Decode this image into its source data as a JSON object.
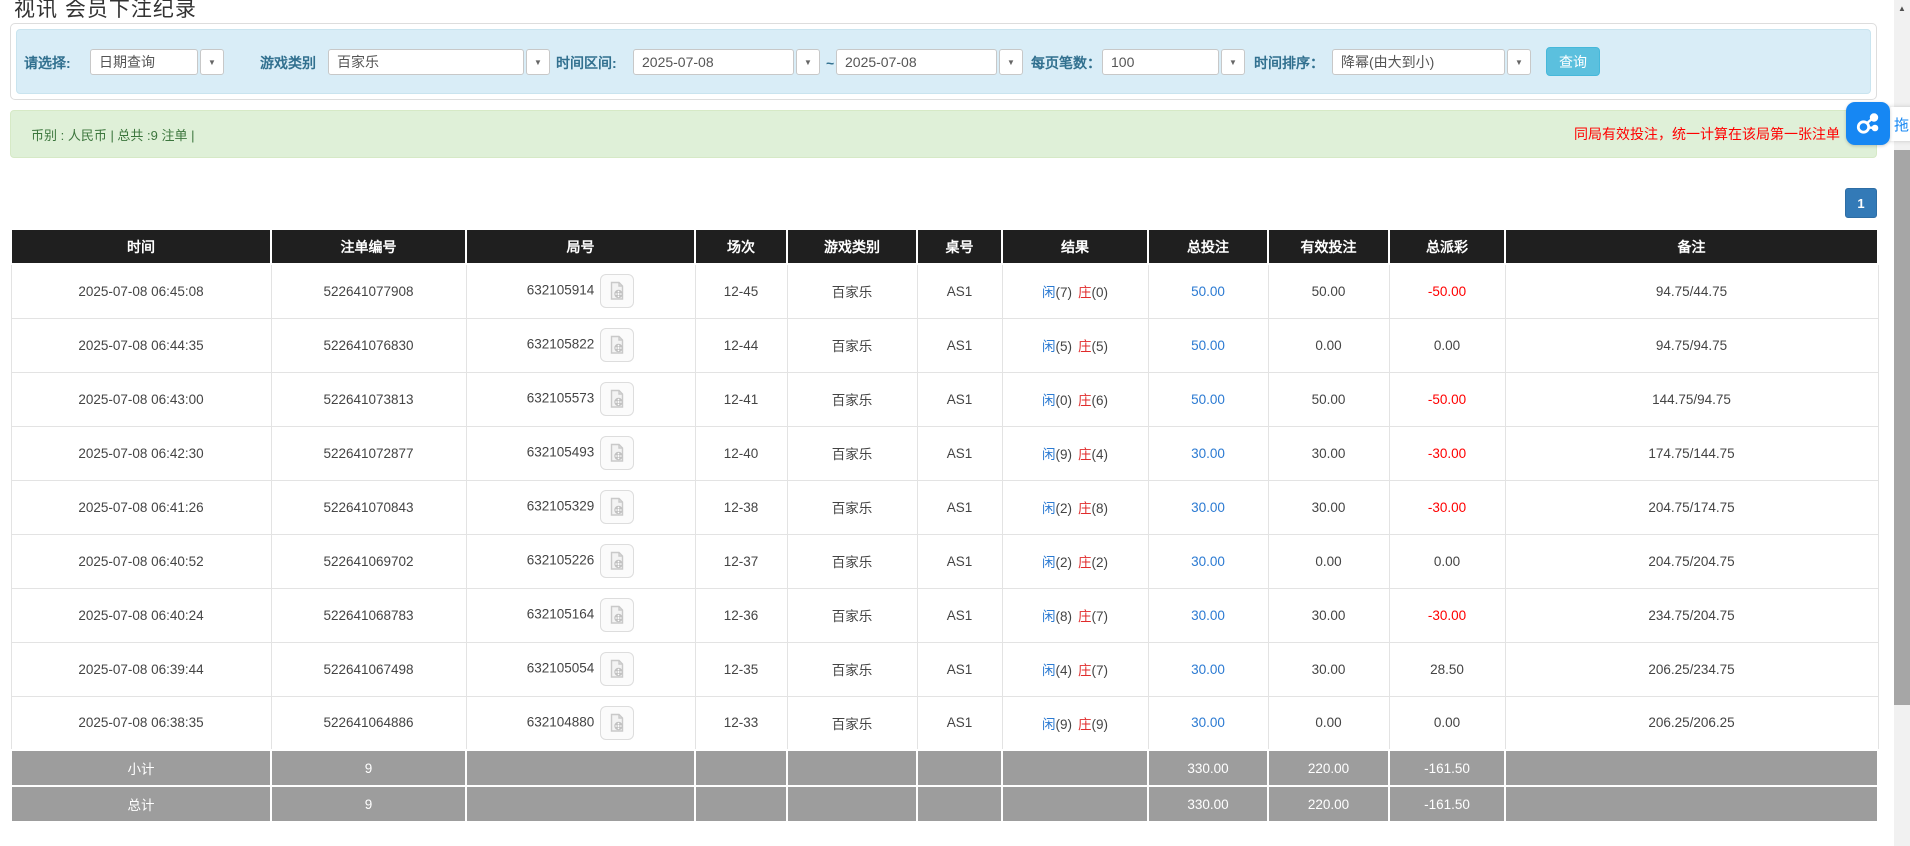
{
  "page": {
    "title": "视讯 会员下注纪录"
  },
  "filters": {
    "select_label": "请选择:",
    "select_value": "日期查询",
    "game_label": "游戏类别",
    "game_value": "百家乐",
    "range_label": "时间区间:",
    "date_from": "2025-07-08",
    "range_separator": "~",
    "date_to": "2025-07-08",
    "page_size_label": "每页笔数：",
    "page_size_value": "100",
    "sort_label": "时间排序：",
    "sort_value": "降幂(由大到小)",
    "search_button": "查询"
  },
  "summary_bar": {
    "left_text": "币别 : 人民币 | 总共 :9 注单 |",
    "right_text": "同局有效投注，统一计算在该局第一张注单"
  },
  "float_widget": {
    "tab_text": "拖"
  },
  "pagination": {
    "current": "1"
  },
  "icons": {
    "dropdown_arrow": "▼",
    "scroll_up_arrow": "▲",
    "video_icon": "video-playback",
    "cloud_icon": "cloud-share"
  },
  "colors": {
    "header_bg": "#1f1f1f",
    "footer_bg": "#9d9d9d",
    "blue_text": "#2b7ad2",
    "red_text": "#ff0000",
    "player_blue": "#2b7ad2",
    "banker_red": "#e02b2b",
    "panel_blue": "#d9edf7",
    "panel_green": "#dff0d8",
    "button_blue": "#5bc0de",
    "pagination_blue": "#337ab7",
    "float_icon_blue": "#1687f3"
  },
  "table": {
    "headers": [
      "时间",
      "注单编号",
      "局号",
      "场次",
      "游戏类别",
      "桌号",
      "结果",
      "总投注",
      "有效投注",
      "总派彩",
      "备注"
    ],
    "rows": [
      {
        "time": "2025-07-08 06:45:08",
        "bet_id": "522641077908",
        "round_id": "632105914",
        "session": "12-45",
        "game": "百家乐",
        "table_no": "AS1",
        "player_label": "闲",
        "player_num": "(7)",
        "banker_label": "庄",
        "banker_num": "(0)",
        "total_bet": "50.00",
        "valid_bet": "50.00",
        "payout": "-50.00",
        "remark": "94.75/44.75"
      },
      {
        "time": "2025-07-08 06:44:35",
        "bet_id": "522641076830",
        "round_id": "632105822",
        "session": "12-44",
        "game": "百家乐",
        "table_no": "AS1",
        "player_label": "闲",
        "player_num": "(5)",
        "banker_label": "庄",
        "banker_num": "(5)",
        "total_bet": "50.00",
        "valid_bet": "0.00",
        "payout": "0.00",
        "remark": "94.75/94.75"
      },
      {
        "time": "2025-07-08 06:43:00",
        "bet_id": "522641073813",
        "round_id": "632105573",
        "session": "12-41",
        "game": "百家乐",
        "table_no": "AS1",
        "player_label": "闲",
        "player_num": "(0)",
        "banker_label": "庄",
        "banker_num": "(6)",
        "total_bet": "50.00",
        "valid_bet": "50.00",
        "payout": "-50.00",
        "remark": "144.75/94.75"
      },
      {
        "time": "2025-07-08 06:42:30",
        "bet_id": "522641072877",
        "round_id": "632105493",
        "session": "12-40",
        "game": "百家乐",
        "table_no": "AS1",
        "player_label": "闲",
        "player_num": "(9)",
        "banker_label": "庄",
        "banker_num": "(4)",
        "total_bet": "30.00",
        "valid_bet": "30.00",
        "payout": "-30.00",
        "remark": "174.75/144.75"
      },
      {
        "time": "2025-07-08 06:41:26",
        "bet_id": "522641070843",
        "round_id": "632105329",
        "session": "12-38",
        "game": "百家乐",
        "table_no": "AS1",
        "player_label": "闲",
        "player_num": "(2)",
        "banker_label": "庄",
        "banker_num": "(8)",
        "total_bet": "30.00",
        "valid_bet": "30.00",
        "payout": "-30.00",
        "remark": "204.75/174.75"
      },
      {
        "time": "2025-07-08 06:40:52",
        "bet_id": "522641069702",
        "round_id": "632105226",
        "session": "12-37",
        "game": "百家乐",
        "table_no": "AS1",
        "player_label": "闲",
        "player_num": "(2)",
        "banker_label": "庄",
        "banker_num": "(2)",
        "total_bet": "30.00",
        "valid_bet": "0.00",
        "payout": "0.00",
        "remark": "204.75/204.75"
      },
      {
        "time": "2025-07-08 06:40:24",
        "bet_id": "522641068783",
        "round_id": "632105164",
        "session": "12-36",
        "game": "百家乐",
        "table_no": "AS1",
        "player_label": "闲",
        "player_num": "(8)",
        "banker_label": "庄",
        "banker_num": "(7)",
        "total_bet": "30.00",
        "valid_bet": "30.00",
        "payout": "-30.00",
        "remark": "234.75/204.75"
      },
      {
        "time": "2025-07-08 06:39:44",
        "bet_id": "522641067498",
        "round_id": "632105054",
        "session": "12-35",
        "game": "百家乐",
        "table_no": "AS1",
        "player_label": "闲",
        "player_num": "(4)",
        "banker_label": "庄",
        "banker_num": "(7)",
        "total_bet": "30.00",
        "valid_bet": "30.00",
        "payout": "28.50",
        "remark": "206.25/234.75"
      },
      {
        "time": "2025-07-08 06:38:35",
        "bet_id": "522641064886",
        "round_id": "632104880",
        "session": "12-33",
        "game": "百家乐",
        "table_no": "AS1",
        "player_label": "闲",
        "player_num": "(9)",
        "banker_label": "庄",
        "banker_num": "(9)",
        "total_bet": "30.00",
        "valid_bet": "0.00",
        "payout": "0.00",
        "remark": "206.25/206.25"
      }
    ],
    "footer": [
      {
        "label": "小计",
        "count": "9",
        "total_bet": "330.00",
        "valid_bet": "220.00",
        "payout": "-161.50"
      },
      {
        "label": "总计",
        "count": "9",
        "total_bet": "330.00",
        "valid_bet": "220.00",
        "payout": "-161.50"
      }
    ]
  }
}
